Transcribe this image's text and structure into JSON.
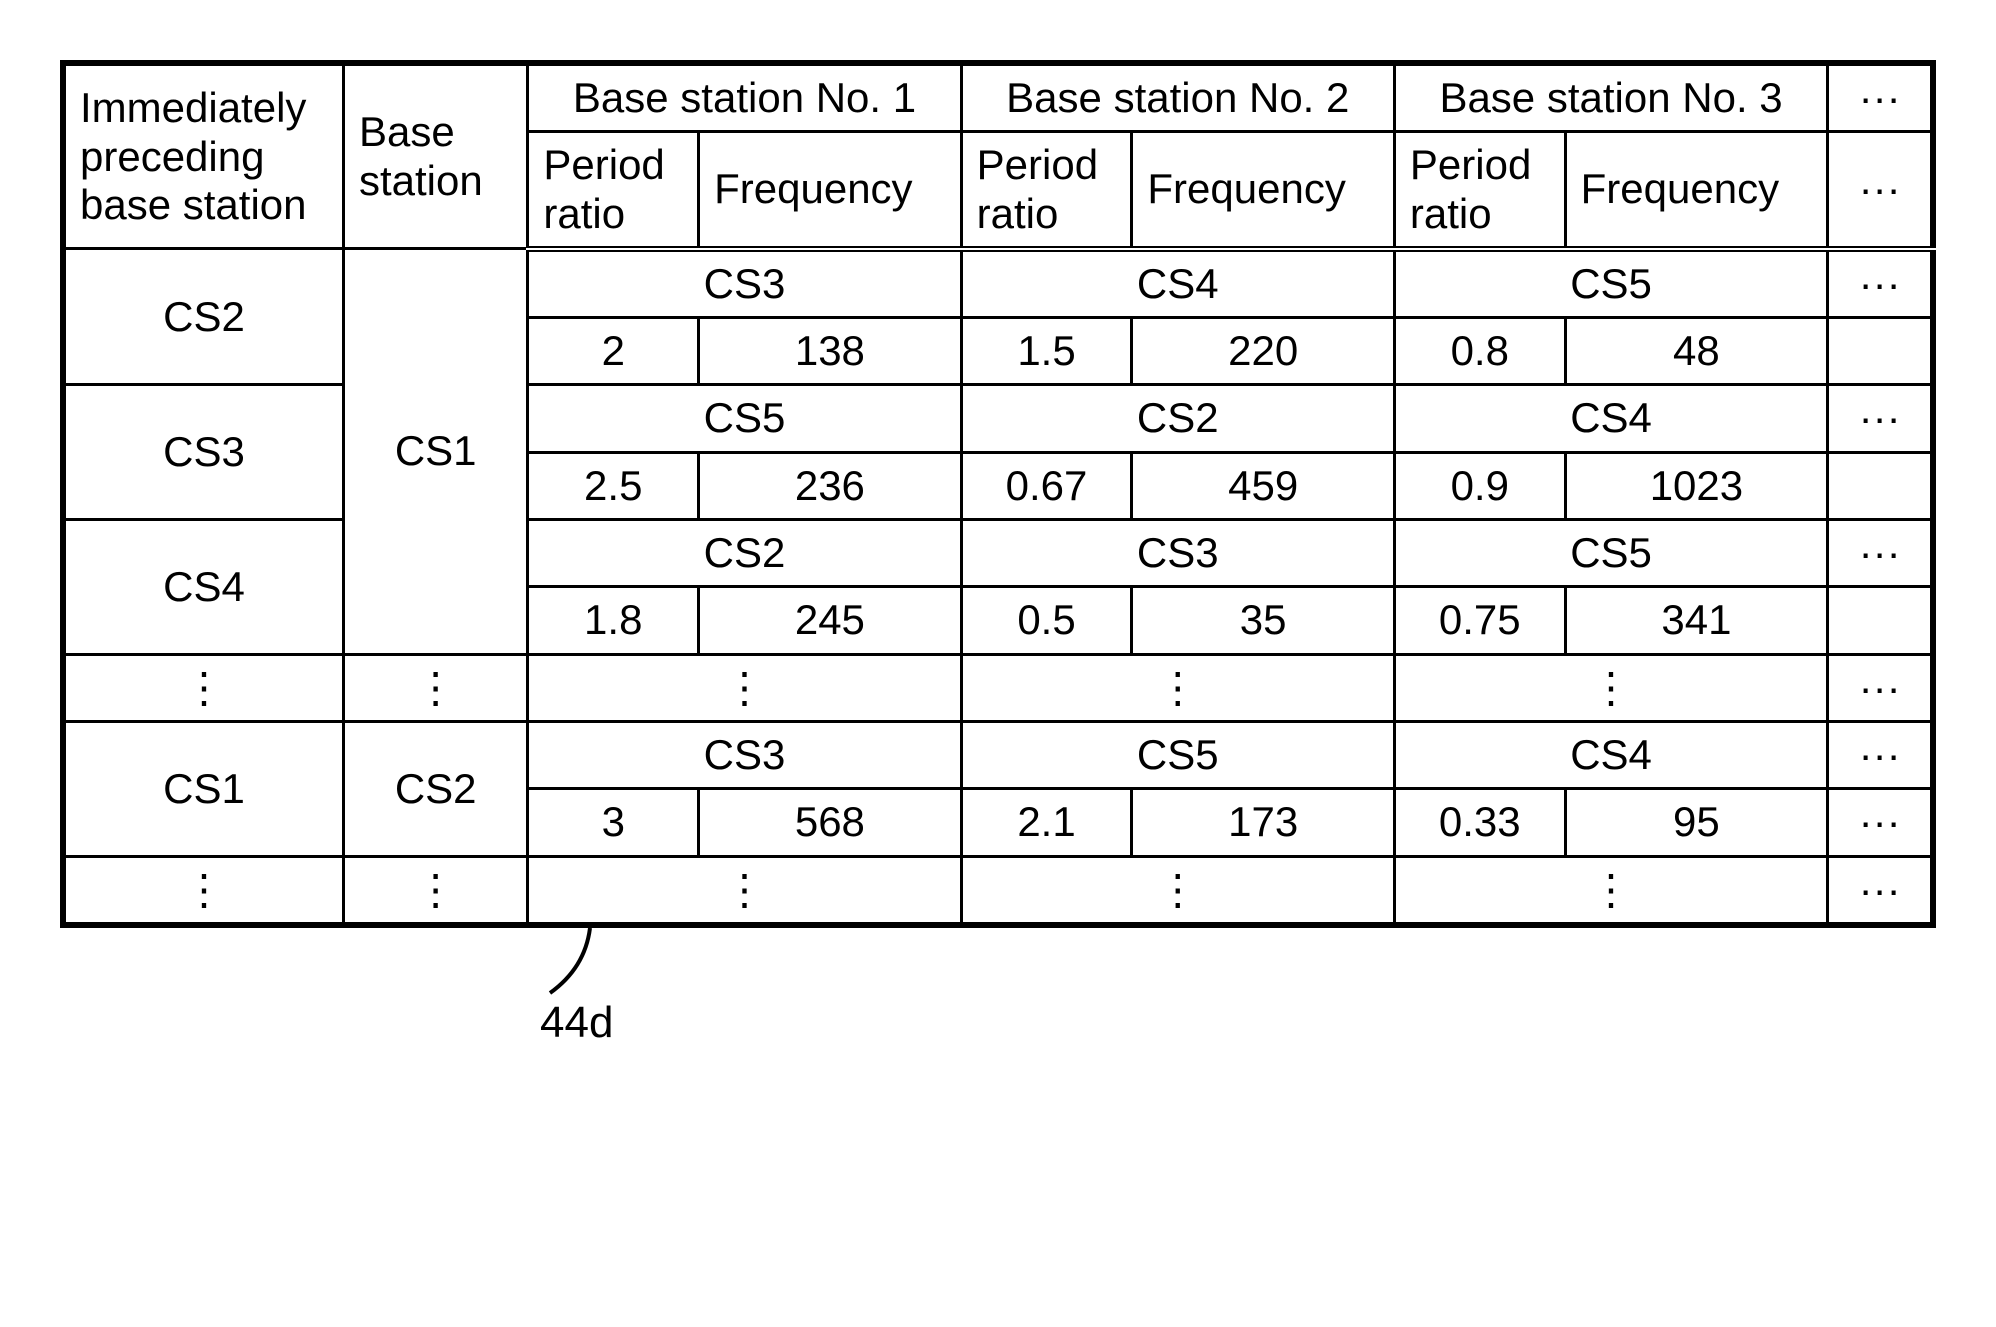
{
  "headers": {
    "precedingBaseStation": "Immediately preceding base station",
    "baseStation": "Base station",
    "bs1": "Base station No. 1",
    "bs2": "Base station No. 2",
    "bs3": "Base station No. 3",
    "periodRatio": "Period ratio",
    "frequency": "Frequency",
    "dots": "···"
  },
  "rows": [
    {
      "preceding": "CS2",
      "base": "CS1",
      "stations": [
        {
          "name": "CS3",
          "ratio": "2",
          "freq": "138"
        },
        {
          "name": "CS4",
          "ratio": "1.5",
          "freq": "220"
        },
        {
          "name": "CS5",
          "ratio": "0.8",
          "freq": "48"
        }
      ],
      "nameRowTrail": "···",
      "valRowTrail": ""
    },
    {
      "preceding": "CS3",
      "base": "CS1",
      "stations": [
        {
          "name": "CS5",
          "ratio": "2.5",
          "freq": "236"
        },
        {
          "name": "CS2",
          "ratio": "0.67",
          "freq": "459"
        },
        {
          "name": "CS4",
          "ratio": "0.9",
          "freq": "1023"
        }
      ],
      "nameRowTrail": "···",
      "valRowTrail": ""
    },
    {
      "preceding": "CS4",
      "base": "CS1",
      "stations": [
        {
          "name": "CS2",
          "ratio": "1.8",
          "freq": "245"
        },
        {
          "name": "CS3",
          "ratio": "0.5",
          "freq": "35"
        },
        {
          "name": "CS5",
          "ratio": "0.75",
          "freq": "341"
        }
      ],
      "nameRowTrail": "···",
      "valRowTrail": ""
    }
  ],
  "ellipsisRow1": {
    "preceding": "⋮",
    "base": "⋮",
    "c1": "⋮",
    "c2": "⋮",
    "c3": "⋮",
    "trail": "···"
  },
  "row4": {
    "preceding": "CS1",
    "base": "CS2",
    "stations": [
      {
        "name": "CS3",
        "ratio": "3",
        "freq": "568"
      },
      {
        "name": "CS5",
        "ratio": "2.1",
        "freq": "173"
      },
      {
        "name": "CS4",
        "ratio": "0.33",
        "freq": "95"
      }
    ],
    "nameRowTrail": "···",
    "valRowTrail": "···"
  },
  "ellipsisRow2": {
    "preceding": "⋮",
    "base": "⋮",
    "c1": "⋮",
    "c2": "⋮",
    "c3": "⋮",
    "trail": "···"
  },
  "annotation": "44d"
}
